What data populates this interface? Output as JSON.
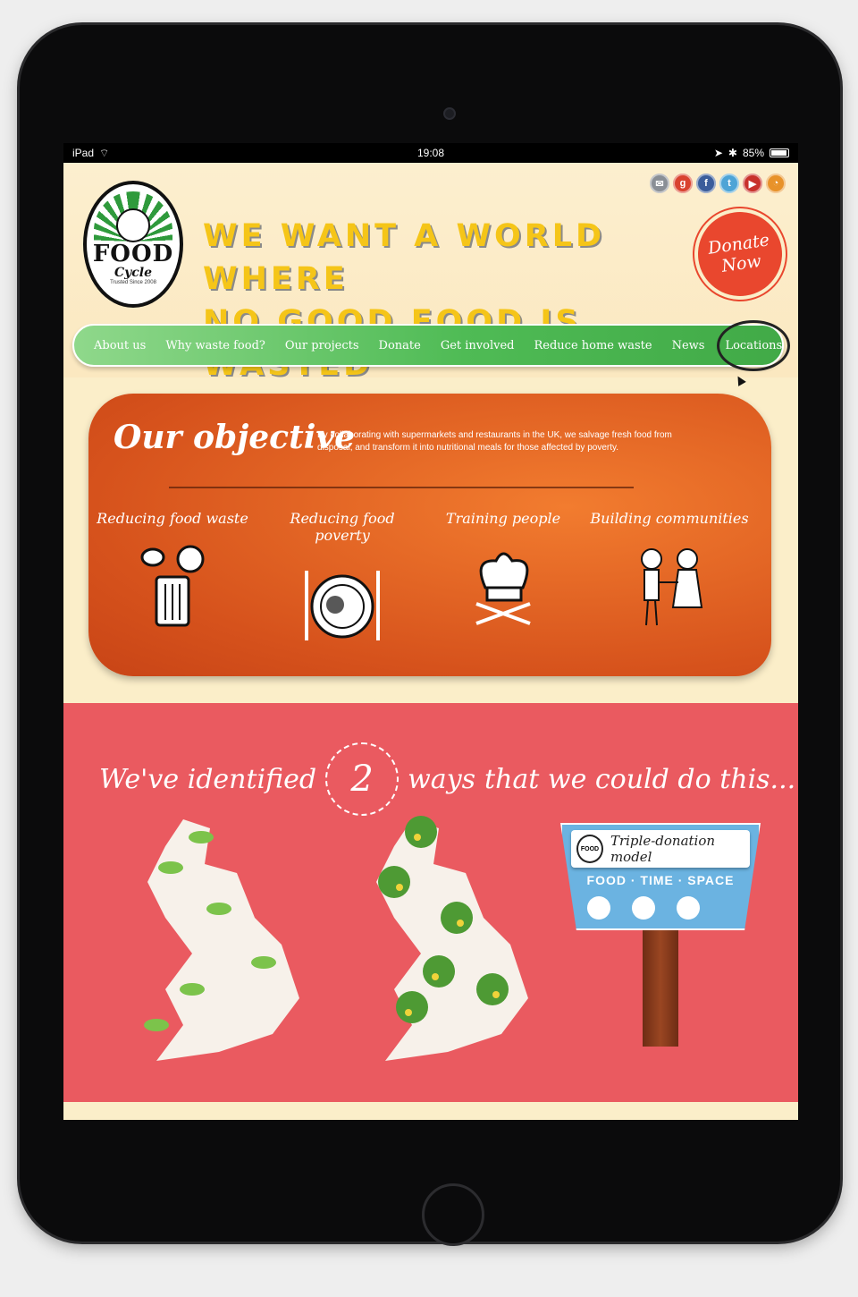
{
  "device": {
    "status_bar": {
      "carrier": "iPad",
      "time": "19:08",
      "battery": "85%"
    }
  },
  "colors": {
    "nav_green": "#4fbb55",
    "objective_orange": "#d6521c",
    "ways_red": "#ea5a60",
    "donate_red": "#e9472e",
    "tagline_yellow": "#f5c518"
  },
  "header": {
    "logo": {
      "name": "FOOD",
      "sub": "Cycle",
      "tiny": "Trusted Since 2008"
    },
    "tagline_line1": "WE WANT A WORLD WHERE",
    "tagline_line2": "NO GOOD FOOD IS WASTED",
    "donate_label": "Donate Now",
    "social_icons": [
      "email-icon",
      "google-plus-icon",
      "facebook-icon",
      "twitter-icon",
      "youtube-icon",
      "rss-icon"
    ]
  },
  "nav": {
    "items": [
      {
        "label": "About us"
      },
      {
        "label": "Why waste food?"
      },
      {
        "label": "Our projects"
      },
      {
        "label": "Donate"
      },
      {
        "label": "Get involved"
      },
      {
        "label": "Reduce home waste"
      },
      {
        "label": "News"
      },
      {
        "label": "Locations"
      }
    ]
  },
  "objective": {
    "title": "Our objective",
    "text": "By collaborating with supermarkets and restaurants in the UK, we salvage fresh food from disposal, and transform it into nutritional meals for those affected by poverty.",
    "columns": [
      {
        "label": "Reducing food waste",
        "icon": "bin-icon"
      },
      {
        "label": "Reducing food poverty",
        "icon": "plate-icon"
      },
      {
        "label": "Training people",
        "icon": "chef-hat-icon"
      },
      {
        "label": "Building communities",
        "icon": "people-icon"
      }
    ]
  },
  "ways": {
    "title_before": "We've identified",
    "number": "2",
    "title_ways": "ways",
    "title_after": "that we could do this...",
    "sign": {
      "title": "Triple-donation model",
      "sub": "FOOD · TIME · SPACE",
      "logo": "FOOD"
    }
  }
}
